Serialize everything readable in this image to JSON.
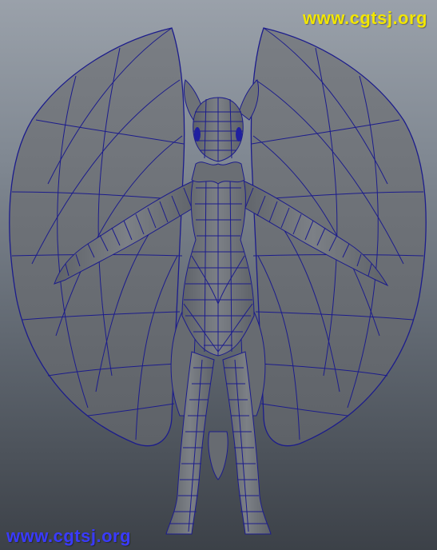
{
  "watermarks": {
    "top": "www.cgtsj.org",
    "bottom": "www.cgtsj.org"
  },
  "colors": {
    "watermark_top": "#f2e600",
    "watermark_bottom": "#3a3aff",
    "wire": "#1c1c8c",
    "surface": "#71757b",
    "surface_shadow": "#54585e",
    "background_top": "#9aa1aa",
    "background_bottom": "#3c4148"
  },
  "viewport": {
    "content": "wireframe-on-shaded character model with wings (T-pose, front view)"
  }
}
